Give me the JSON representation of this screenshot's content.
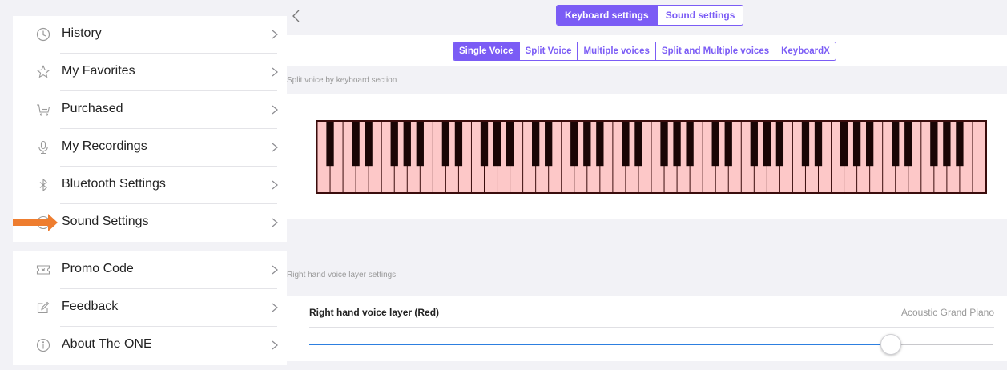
{
  "sidebar": {
    "items": [
      {
        "label": "History",
        "icon": "clock-icon"
      },
      {
        "label": "My Favorites",
        "icon": "star-icon"
      },
      {
        "label": "Purchased",
        "icon": "cart-icon"
      },
      {
        "label": "My Recordings",
        "icon": "microphone-icon"
      },
      {
        "label": "Bluetooth Settings",
        "icon": "bluetooth-icon"
      },
      {
        "label": "Sound Settings",
        "icon": "sound-icon"
      }
    ],
    "items2": [
      {
        "label": "Promo Code",
        "icon": "ticket-icon"
      },
      {
        "label": "Feedback",
        "icon": "edit-icon"
      },
      {
        "label": "About The ONE",
        "icon": "info-icon"
      }
    ],
    "pointer_color": "#ee7d2f"
  },
  "header": {
    "tabs": [
      {
        "label": "Keyboard settings",
        "active": true
      },
      {
        "label": "Sound settings",
        "active": false
      }
    ]
  },
  "subtabs": [
    {
      "label": "Single Voice",
      "active": true
    },
    {
      "label": "Split Voice",
      "active": false
    },
    {
      "label": "Multiple voices",
      "active": false
    },
    {
      "label": "Split and Multiple voices",
      "active": false
    },
    {
      "label": "KeyboardX",
      "active": false
    }
  ],
  "keyboard_section": {
    "caption": "Split voice by keyboard section",
    "white_key_count": 52,
    "white_key_color": "#fdc8c8",
    "outline_color": "#3a0c0c",
    "black_key_color": "#1a0505"
  },
  "layer_section": {
    "caption": "Right hand voice layer settings",
    "title": "Right hand voice layer (Red)",
    "voice": "Acoustic Grand Piano",
    "slider_value": 0.85
  },
  "colors": {
    "accent": "#7b5cf5",
    "slider_fill": "#2d7fe0"
  }
}
